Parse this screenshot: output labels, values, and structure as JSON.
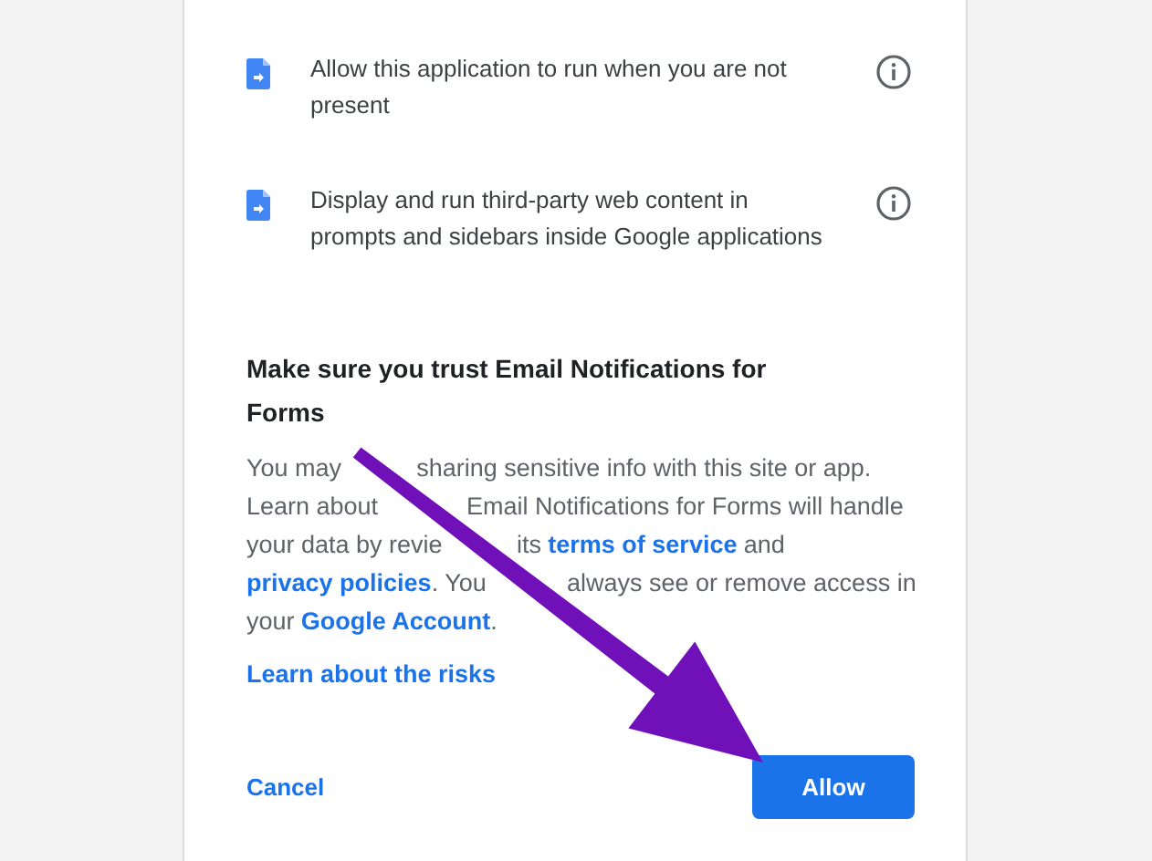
{
  "permissions": [
    {
      "text": "Allow this application to run when you are not present"
    },
    {
      "text": "Display and run third-party web content in prompts and sidebars inside Google applications"
    }
  ],
  "heading": "Make sure you trust Email Notifications for Forms",
  "paragraph_lines": [
    {
      "before_arrow": [
        {
          "kind": "text",
          "text": "You may"
        }
      ],
      "after_arrow": [
        {
          "kind": "text",
          "text": "sharing sensitive info with this site or app."
        }
      ]
    },
    {
      "before_arrow": [
        {
          "kind": "text",
          "text": "Learn about"
        }
      ],
      "after_arrow": [
        {
          "kind": "text",
          "text": "Email Notifications for Forms will handle"
        }
      ]
    },
    {
      "before_arrow": [
        {
          "kind": "text",
          "text": "your data by revie"
        }
      ],
      "after_arrow": [
        {
          "kind": "text",
          "text": "its"
        },
        {
          "kind": "link",
          "text": "terms of service"
        },
        {
          "kind": "text",
          "text": "and"
        }
      ]
    },
    {
      "before_arrow": [
        {
          "kind": "link",
          "text": "privacy policies"
        },
        {
          "kind": "text",
          "text": ". You"
        }
      ],
      "after_arrow": [
        {
          "kind": "text",
          "text": "always see or remove access in"
        }
      ]
    },
    {
      "before_arrow": [
        {
          "kind": "text",
          "text": "your"
        },
        {
          "kind": "link",
          "text": "Google Account"
        },
        {
          "kind": "text",
          "text": "."
        }
      ]
    }
  ],
  "risks_link": "Learn about the risks",
  "buttons": [
    {
      "label": "Cancel",
      "kind": "text"
    },
    {
      "label": "Allow",
      "kind": "primary"
    }
  ]
}
